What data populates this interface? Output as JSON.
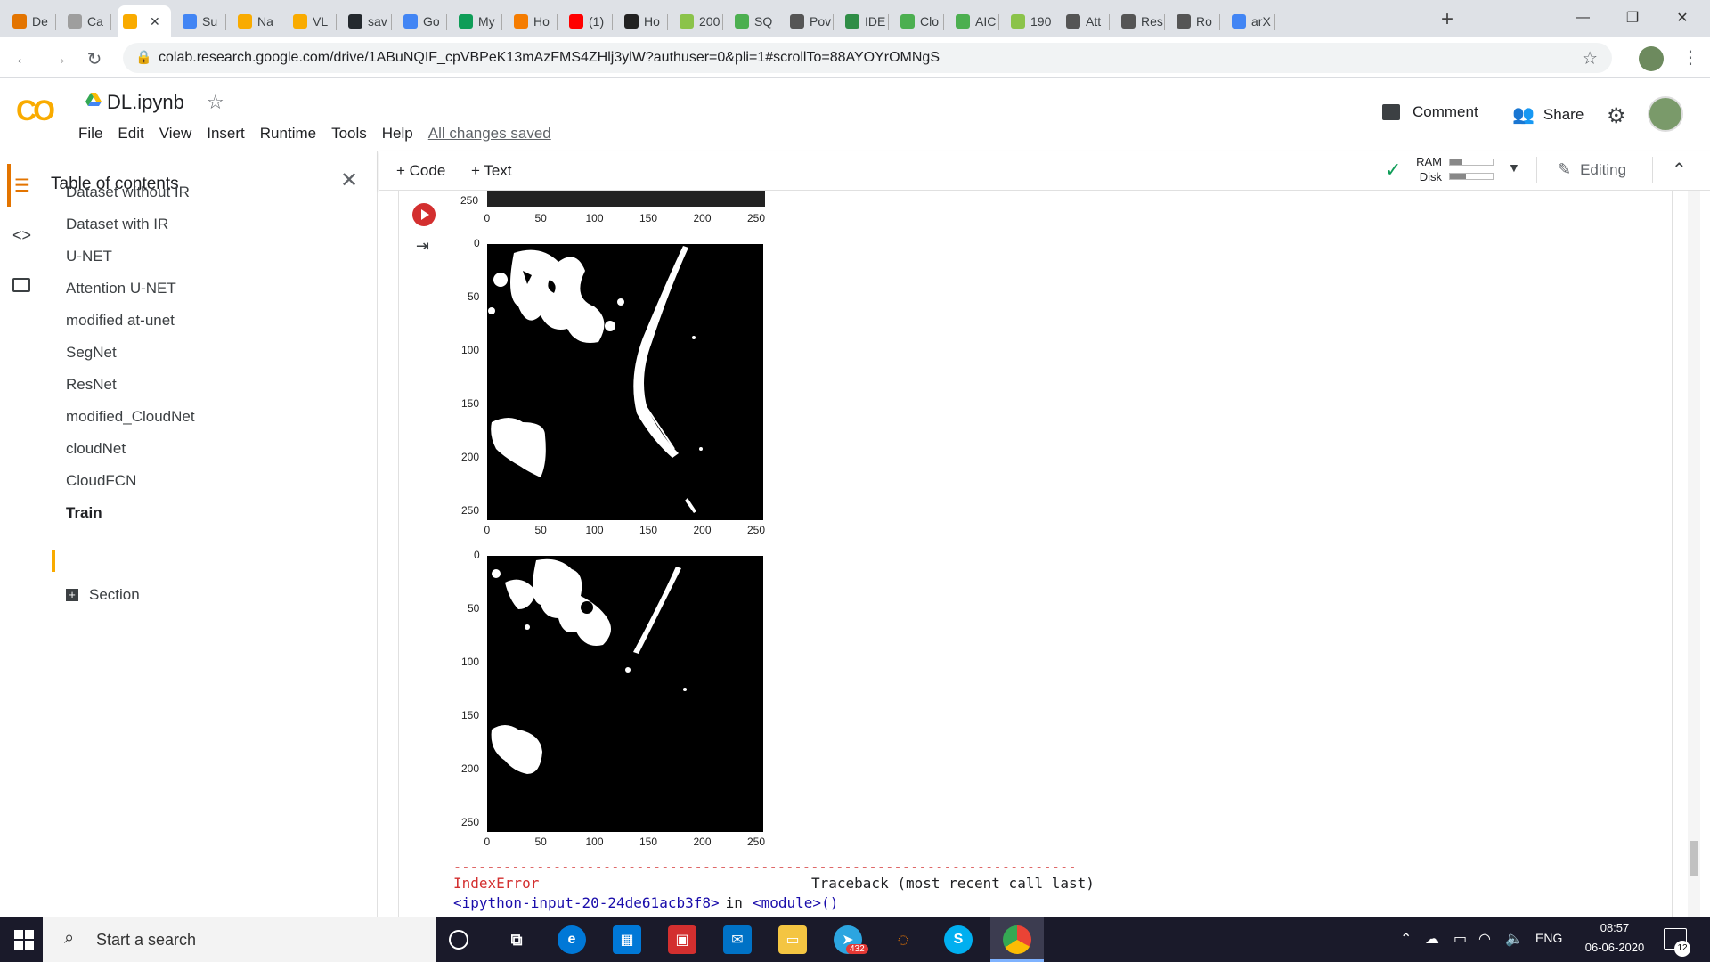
{
  "browser": {
    "tabs": [
      {
        "label": "De",
        "color": "#e37400"
      },
      {
        "label": "Ca",
        "color": "#9e9e9e"
      },
      {
        "label": "",
        "color": "#f9ab00",
        "active": true
      },
      {
        "label": "Su",
        "color": "#4285f4"
      },
      {
        "label": "Na",
        "color": "#f9ab00"
      },
      {
        "label": "VL",
        "color": "#f9ab00"
      },
      {
        "label": "sav",
        "color": "#24292e"
      },
      {
        "label": "Go",
        "color": "#4285f4"
      },
      {
        "label": "My",
        "color": "#0f9d58"
      },
      {
        "label": "Ho",
        "color": "#f57c00"
      },
      {
        "label": "(1)",
        "color": "#ff0000"
      },
      {
        "label": "Ho",
        "color": "#222222"
      },
      {
        "label": "200",
        "color": "#8bc34a"
      },
      {
        "label": "SQ",
        "color": "#4caf50"
      },
      {
        "label": "Pov",
        "color": "#555555"
      },
      {
        "label": "IDE",
        "color": "#2f8d46"
      },
      {
        "label": "Clo",
        "color": "#4caf50"
      },
      {
        "label": "AIC",
        "color": "#4caf50"
      },
      {
        "label": "190",
        "color": "#8bc34a"
      },
      {
        "label": "Att",
        "color": "#555555"
      },
      {
        "label": "Res",
        "color": "#555555"
      },
      {
        "label": "Ro",
        "color": "#555555"
      },
      {
        "label": "arX",
        "color": "#4285f4"
      }
    ],
    "close_tab_glyph": "✕",
    "new_tab_glyph": "+",
    "window": {
      "minimize": "—",
      "restore": "❐",
      "close": "✕"
    },
    "url": "colab.research.google.com/drive/1ABuNQIF_cpVBPeK13mAzFMS4ZHlj3ylW?authuser=0&pli=1#scrollTo=88AYOYrOMNgS"
  },
  "colab": {
    "logo": "CO",
    "doc_name": "DL.ipynb",
    "menus": [
      "File",
      "Edit",
      "View",
      "Insert",
      "Runtime",
      "Tools",
      "Help"
    ],
    "saved_status": "All changes saved",
    "comment_label": "Comment",
    "share_label": "Share"
  },
  "toc": {
    "title": "Table of contents",
    "items": [
      "Dataset without IR",
      "Dataset with IR",
      "U-NET",
      "Attention U-NET",
      "modified at-unet",
      "SegNet",
      "ResNet",
      "modified_CloudNet",
      "cloudNet",
      "CloudFCN",
      "Train"
    ],
    "section_label": "Section"
  },
  "toolbar": {
    "add_code": "+ Code",
    "add_text": "+ Text",
    "ram_label": "RAM",
    "disk_label": "Disk",
    "ram_usage": 0.28,
    "disk_usage": 0.38,
    "editing_label": "Editing"
  },
  "output": {
    "tick_labels_x": [
      "0",
      "50",
      "100",
      "150",
      "200",
      "250"
    ],
    "tick_labels_y": [
      "0",
      "50",
      "100",
      "150",
      "200",
      "250"
    ],
    "top_partial_y_label": "250",
    "error_dashes": "---------------------------------------------------------------------------",
    "error_name": "IndexError",
    "traceback_header": "Traceback (most recent call last)",
    "input_link": "<ipython-input-20-24de61acb3f8>",
    "in_text": " in ",
    "module_text": "<module>()"
  },
  "taskbar": {
    "search_placeholder": "Start a search",
    "lang": "ENG",
    "time": "08:57",
    "date": "06-06-2020",
    "notification_count": "12",
    "telegram_badge": "432"
  }
}
